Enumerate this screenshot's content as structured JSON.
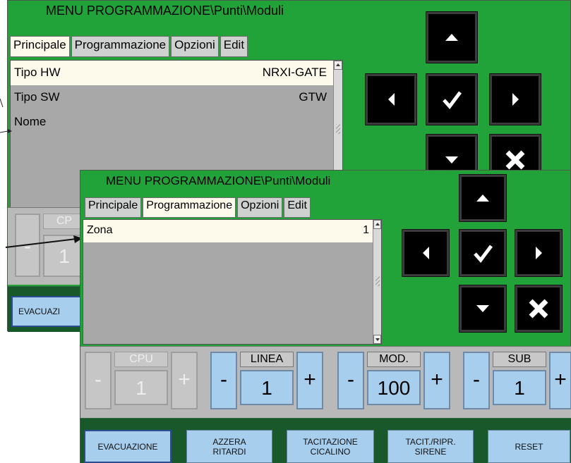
{
  "back": {
    "title": "MENU PROGRAMMAZIONE\\Punti\\Moduli",
    "tabs": [
      {
        "label": "Principale",
        "active": true
      },
      {
        "label": "Programmazione",
        "active": false
      },
      {
        "label": "Opzioni",
        "active": false
      },
      {
        "label": "Edit",
        "active": false
      }
    ],
    "rows": [
      {
        "key": "Tipo HW",
        "value": "NRXI-GATE",
        "selected": true
      },
      {
        "key": "Tipo SW",
        "value": "GTW",
        "selected": false
      },
      {
        "key": "Nome",
        "value": "",
        "selected": false
      }
    ],
    "cpu": {
      "label": "CP",
      "value": "1",
      "minus": "-"
    },
    "footer_first": "EVACUAZI"
  },
  "front": {
    "title": "MENU PROGRAMMAZIONE\\Punti\\Moduli",
    "tabs": [
      {
        "label": "Principale",
        "active": false
      },
      {
        "label": "Programmazione",
        "active": true
      },
      {
        "label": "Opzioni",
        "active": false
      },
      {
        "label": "Edit",
        "active": false
      }
    ],
    "rows": [
      {
        "key": "Zona",
        "value": "1",
        "selected": true
      }
    ],
    "controls": [
      {
        "label": "CPU",
        "value": "1",
        "minus": "-",
        "plus": "+",
        "enabled": false
      },
      {
        "label": "LINEA",
        "value": "1",
        "minus": "-",
        "plus": "+",
        "enabled": true
      },
      {
        "label": "MOD.",
        "value": "100",
        "minus": "-",
        "plus": "+",
        "enabled": true
      },
      {
        "label": "SUB",
        "value": "1",
        "minus": "-",
        "plus": "+",
        "enabled": true
      }
    ],
    "footer": [
      {
        "line1": "EVACUAZIONE",
        "line2": ""
      },
      {
        "line1": "AZZERA",
        "line2": "RITARDI"
      },
      {
        "line1": "TACITAZIONE",
        "line2": "CICALINO"
      },
      {
        "line1": "TACIT./RIPR.",
        "line2": "SIRENE"
      },
      {
        "line1": "RESET",
        "line2": ""
      }
    ]
  },
  "nav_icons": [
    "up-arrow-icon",
    "left-arrow-icon",
    "check-icon",
    "right-arrow-icon",
    "down-arrow-icon",
    "cancel-x-icon"
  ],
  "colors": {
    "panel": "#22a33a",
    "selected_row": "#fefaeb",
    "button_blue": "#a8ceee",
    "footer": "#18582a"
  }
}
